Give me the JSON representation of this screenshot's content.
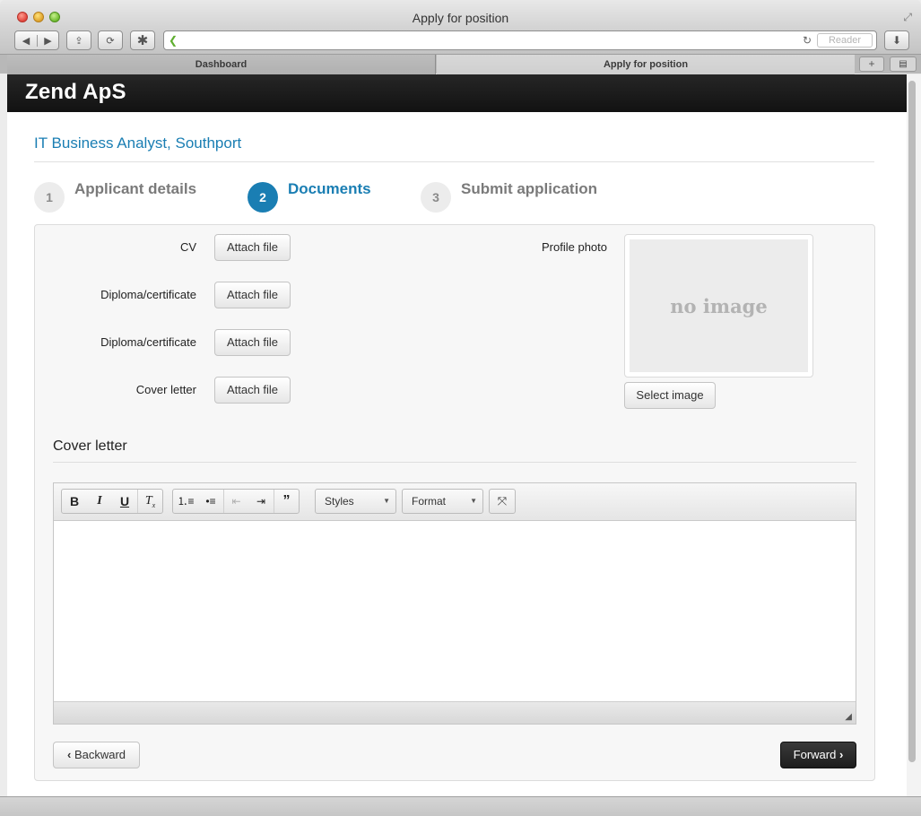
{
  "window": {
    "title": "Apply for position",
    "reader_label": "Reader"
  },
  "tabs": [
    {
      "label": "Dashboard"
    },
    {
      "label": "Apply for position"
    }
  ],
  "navbar": {
    "brand": "Zend ApS"
  },
  "job": {
    "title": "IT Business Analyst, Southport"
  },
  "steps": [
    {
      "number": "1",
      "label": "Applicant details"
    },
    {
      "number": "2",
      "label": "Documents",
      "active": true
    },
    {
      "number": "3",
      "label": "Submit application"
    }
  ],
  "documents": [
    {
      "label": "CV",
      "button": "Attach file"
    },
    {
      "label": "Diploma/certificate",
      "button": "Attach file"
    },
    {
      "label": "Diploma/certificate",
      "button": "Attach file"
    },
    {
      "label": "Cover letter",
      "button": "Attach file"
    }
  ],
  "photo": {
    "label": "Profile photo",
    "placeholder": "no image",
    "button": "Select image"
  },
  "cover_letter": {
    "heading": "Cover letter",
    "editor": {
      "styles_label": "Styles",
      "format_label": "Format",
      "content": ""
    }
  },
  "footer": {
    "backward_label": "Backward",
    "forward_label": "Forward"
  },
  "colors": {
    "accent": "#1a7eb3",
    "navbar": "#1a1a1a",
    "primary_button": "#222222"
  }
}
